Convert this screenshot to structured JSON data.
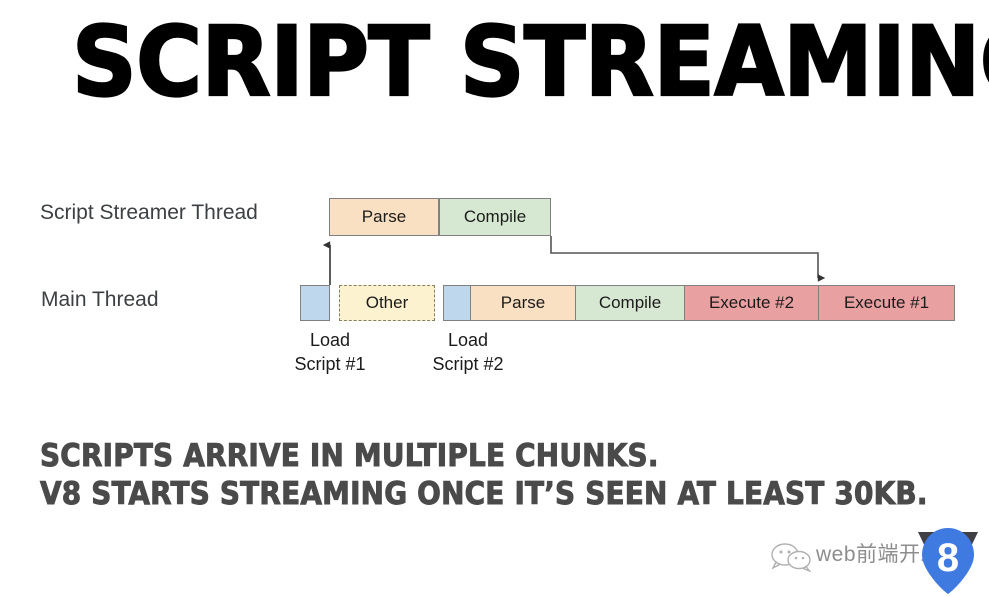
{
  "slide": {
    "title": "SCRIPT STREAMING",
    "background_color": "#ffffff"
  },
  "diagram": {
    "rows": [
      {
        "label": "Script Streamer Thread"
      },
      {
        "label": "Main Thread"
      }
    ],
    "streamer_thread_blocks": [
      {
        "label": "Parse",
        "color": "#fae0c3"
      },
      {
        "label": "Compile",
        "color": "#d7e8d2"
      }
    ],
    "main_thread_blocks": [
      {
        "label": "",
        "color": "#bfd7ed",
        "kind": "load"
      },
      {
        "label": "Other",
        "color": "#fdf2cf",
        "kind": "dashed"
      },
      {
        "label": "",
        "color": "#bfd7ed",
        "kind": "load"
      },
      {
        "label": "Parse",
        "color": "#fae0c3",
        "kind": "solid"
      },
      {
        "label": "Compile",
        "color": "#d7e8d2",
        "kind": "solid"
      },
      {
        "label": "Execute #2",
        "color": "#e8a0a0",
        "kind": "solid"
      },
      {
        "label": "Execute #1",
        "color": "#e8a0a0",
        "kind": "solid"
      }
    ],
    "load_captions": [
      "Load\nScript #1",
      "Load\nScript #2"
    ],
    "arrows": [
      {
        "name": "load-script-1-to-streamer-parse",
        "direction": "up"
      },
      {
        "name": "streamer-compile-to-main-execute",
        "direction": "down-right"
      }
    ]
  },
  "caption": {
    "line1": "SCRIPTS ARRIVE IN MULTIPLE CHUNKS.",
    "line2": "V8 STARTS STREAMING ONCE IT’S SEEN AT LEAST 30KB.",
    "color": "#4a4a4a"
  },
  "watermark": {
    "text": "web前端开发",
    "wechat_icon": "wechat-icon",
    "logo": "v8-logo",
    "logo_color": "#3f7ae0",
    "text_color": "#8d8d8d"
  }
}
